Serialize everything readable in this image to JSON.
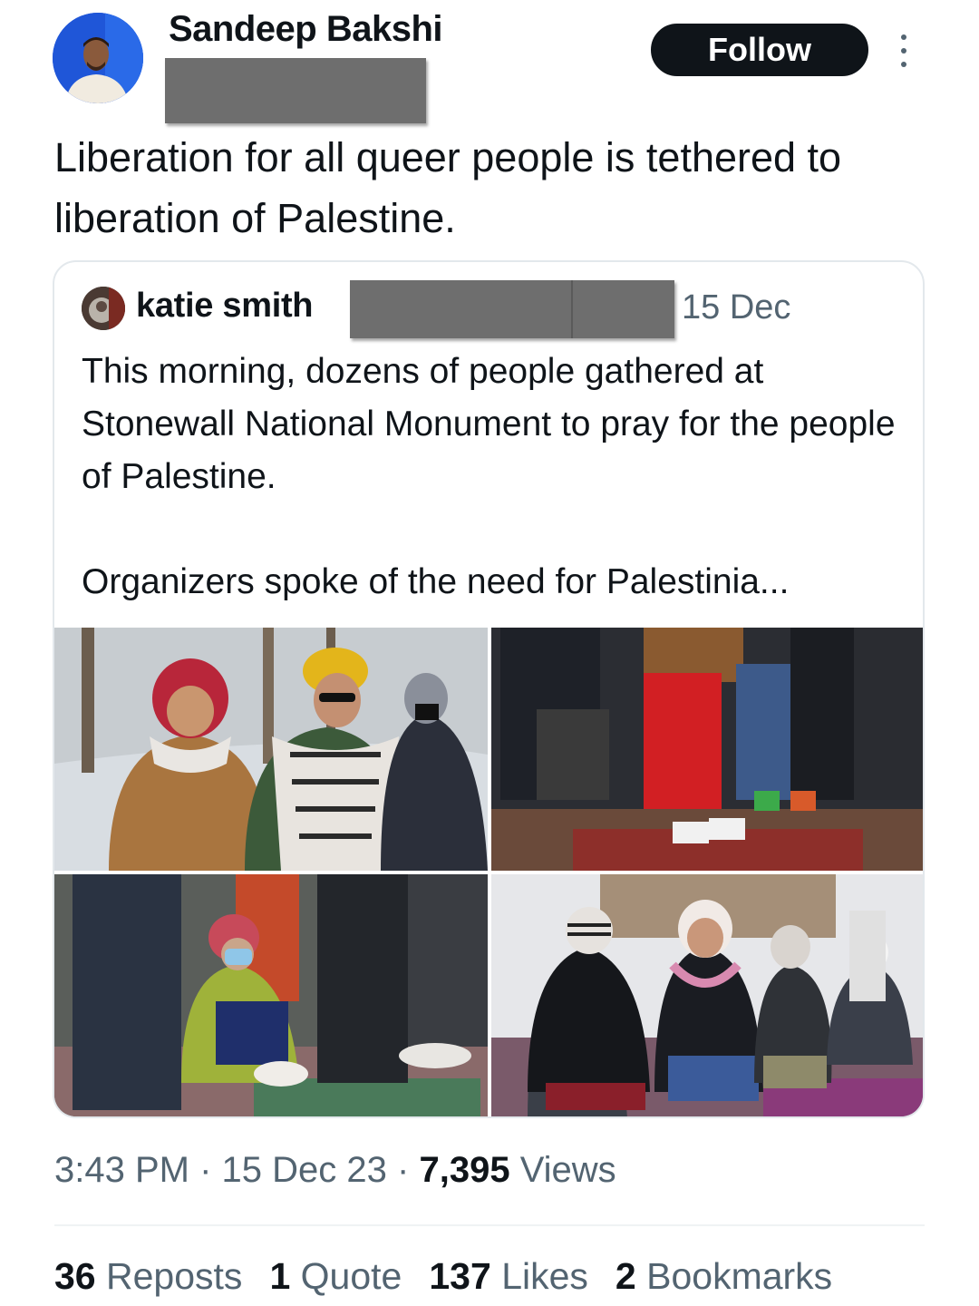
{
  "tweet": {
    "author_name": "Sandeep Bakshi",
    "follow_label": "Follow",
    "text": "Liberation for all queer people is tethered to liberation of Palestine."
  },
  "quote": {
    "author_name": "katie smith",
    "date": "15 Dec",
    "paragraph_1": "This morning, dozens of people gathered at Stonewall National Monument to pray for the people of Palestine.",
    "paragraph_2": "Organizers spoke of the need for Palestinia..."
  },
  "meta": {
    "time": "3:43 PM",
    "sep1": "·",
    "date": "15 Dec 23",
    "sep2": "·",
    "views_count": "7,395",
    "views_label": "Views"
  },
  "stats": {
    "reposts_count": "36",
    "reposts_label": "Reposts",
    "quotes_count": "1",
    "quotes_label": "Quote",
    "likes_count": "137",
    "likes_label": "Likes",
    "bookmarks_count": "2",
    "bookmarks_label": "Bookmarks"
  },
  "icons": {
    "more": "more-vertical-icon"
  },
  "colors": {
    "text_primary": "#0f1419",
    "text_secondary": "#536471",
    "follow_bg": "#0f1419",
    "border": "#e3e8ec",
    "redaction": "#6e6e6e"
  }
}
